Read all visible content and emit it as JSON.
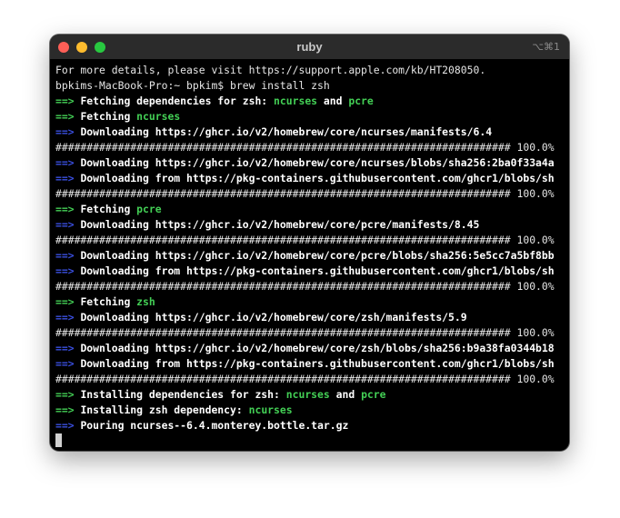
{
  "window": {
    "title": "ruby",
    "shortcut": "⌥⌘1"
  },
  "terminal": {
    "lines": [
      {
        "type": "plain",
        "text": "For more details, please visit https://support.apple.com/kb/HT208050."
      },
      {
        "type": "prompt",
        "text": "bpkims-MacBook-Pro:~ bpkim$ brew install zsh"
      },
      {
        "type": "heading",
        "arrow": "==>",
        "parts": [
          "Fetching dependencies for zsh: ",
          "ncurses",
          " and ",
          "pcre"
        ]
      },
      {
        "type": "heading",
        "arrow": "==>",
        "parts": [
          "Fetching ",
          "ncurses"
        ]
      },
      {
        "type": "info",
        "arrow": "==>",
        "text": "Downloading https://ghcr.io/v2/homebrew/core/ncurses/manifests/6.4"
      },
      {
        "type": "progress",
        "text": "######################################################################### 100.0%"
      },
      {
        "type": "info",
        "arrow": "==>",
        "text": "Downloading https://ghcr.io/v2/homebrew/core/ncurses/blobs/sha256:2ba0f33a4a"
      },
      {
        "type": "info",
        "arrow": "==>",
        "text": "Downloading from https://pkg-containers.githubusercontent.com/ghcr1/blobs/sh"
      },
      {
        "type": "progress",
        "text": "######################################################################### 100.0%"
      },
      {
        "type": "heading",
        "arrow": "==>",
        "parts": [
          "Fetching ",
          "pcre"
        ]
      },
      {
        "type": "info",
        "arrow": "==>",
        "text": "Downloading https://ghcr.io/v2/homebrew/core/pcre/manifests/8.45"
      },
      {
        "type": "progress",
        "text": "######################################################################### 100.0%"
      },
      {
        "type": "info",
        "arrow": "==>",
        "text": "Downloading https://ghcr.io/v2/homebrew/core/pcre/blobs/sha256:5e5cc7a5bf8bb"
      },
      {
        "type": "info",
        "arrow": "==>",
        "text": "Downloading from https://pkg-containers.githubusercontent.com/ghcr1/blobs/sh"
      },
      {
        "type": "progress",
        "text": "######################################################################### 100.0%"
      },
      {
        "type": "heading",
        "arrow": "==>",
        "parts": [
          "Fetching ",
          "zsh"
        ]
      },
      {
        "type": "info",
        "arrow": "==>",
        "text": "Downloading https://ghcr.io/v2/homebrew/core/zsh/manifests/5.9"
      },
      {
        "type": "progress",
        "text": "######################################################################### 100.0%"
      },
      {
        "type": "info",
        "arrow": "==>",
        "text": "Downloading https://ghcr.io/v2/homebrew/core/zsh/blobs/sha256:b9a38fa0344b18"
      },
      {
        "type": "info",
        "arrow": "==>",
        "text": "Downloading from https://pkg-containers.githubusercontent.com/ghcr1/blobs/sh"
      },
      {
        "type": "progress",
        "text": "######################################################################### 100.0%"
      },
      {
        "type": "heading",
        "arrow": "==>",
        "parts": [
          "Installing dependencies for zsh: ",
          "ncurses",
          " and ",
          "pcre"
        ]
      },
      {
        "type": "heading",
        "arrow": "==>",
        "parts": [
          "Installing zsh dependency: ",
          "ncurses"
        ]
      },
      {
        "type": "info",
        "arrow": "==>",
        "text": "Pouring ncurses--6.4.monterey.bottle.tar.gz"
      }
    ]
  },
  "colors": {
    "heading_arrow": "#43cf55",
    "info_arrow": "#3a4fe0",
    "package": "#43cf55",
    "background": "#000000",
    "titlebar": "#2b2b2b"
  }
}
